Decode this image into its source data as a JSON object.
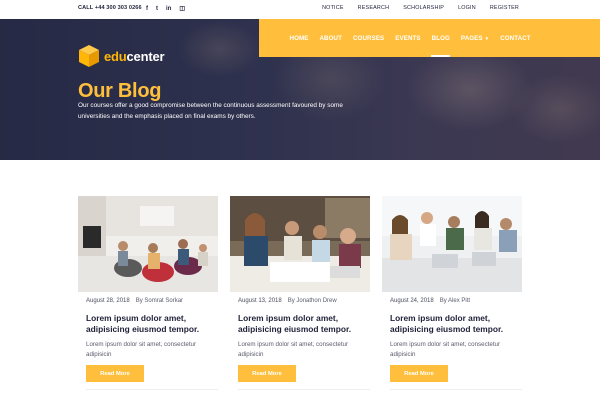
{
  "topbar": {
    "call": "CALL +44 300 303 0266",
    "social_icons": [
      {
        "name": "facebook-icon",
        "glyph": "f"
      },
      {
        "name": "twitter-icon",
        "glyph": "t"
      },
      {
        "name": "linkedin-icon",
        "glyph": "in"
      },
      {
        "name": "instagram-icon",
        "glyph": "◫"
      }
    ],
    "links": [
      "NOTICE",
      "RESEARCH",
      "SCHOLARSHIP",
      "LOGIN",
      "REGISTER"
    ]
  },
  "brand": {
    "prefix": "edu",
    "suffix": "center"
  },
  "nav": {
    "items": [
      "HOME",
      "ABOUT",
      "COURSES",
      "EVENTS",
      "BLOG",
      "PAGES",
      "CONTACT"
    ],
    "active": "BLOG",
    "caret_item": "PAGES"
  },
  "hero": {
    "title": "Our Blog",
    "description": "Our courses offer a good compromise between the continuous assessment favoured by some universities and the emphasis placed on final exams by others."
  },
  "posts": [
    {
      "date": "August 28, 2018",
      "author": "By Somrat Sorkar",
      "title": "Lorem ipsum dolor amet, adipisicing eiusmod tempor.",
      "excerpt": "Lorem ipsum dolor sit amet, consectetur adipisicin",
      "button": "Read More"
    },
    {
      "date": "August 13, 2018",
      "author": "By Jonathon Drew",
      "title": "Lorem ipsum dolor amet, adipisicing eiusmod tempor.",
      "excerpt": "Lorem ipsum dolor sit amet, consectetur adipisicin",
      "button": "Read More"
    },
    {
      "date": "August 24, 2018",
      "author": "By Alex Pitt",
      "title": "Lorem ipsum dolor amet, adipisicing eiusmod tempor.",
      "excerpt": "Lorem ipsum dolor sit amet, consectetur adipisicin",
      "button": "Read More"
    }
  ],
  "colors": {
    "accent": "#ffbf3c",
    "dark": "#1e2139",
    "hero_bg": "#2b2e4c"
  }
}
